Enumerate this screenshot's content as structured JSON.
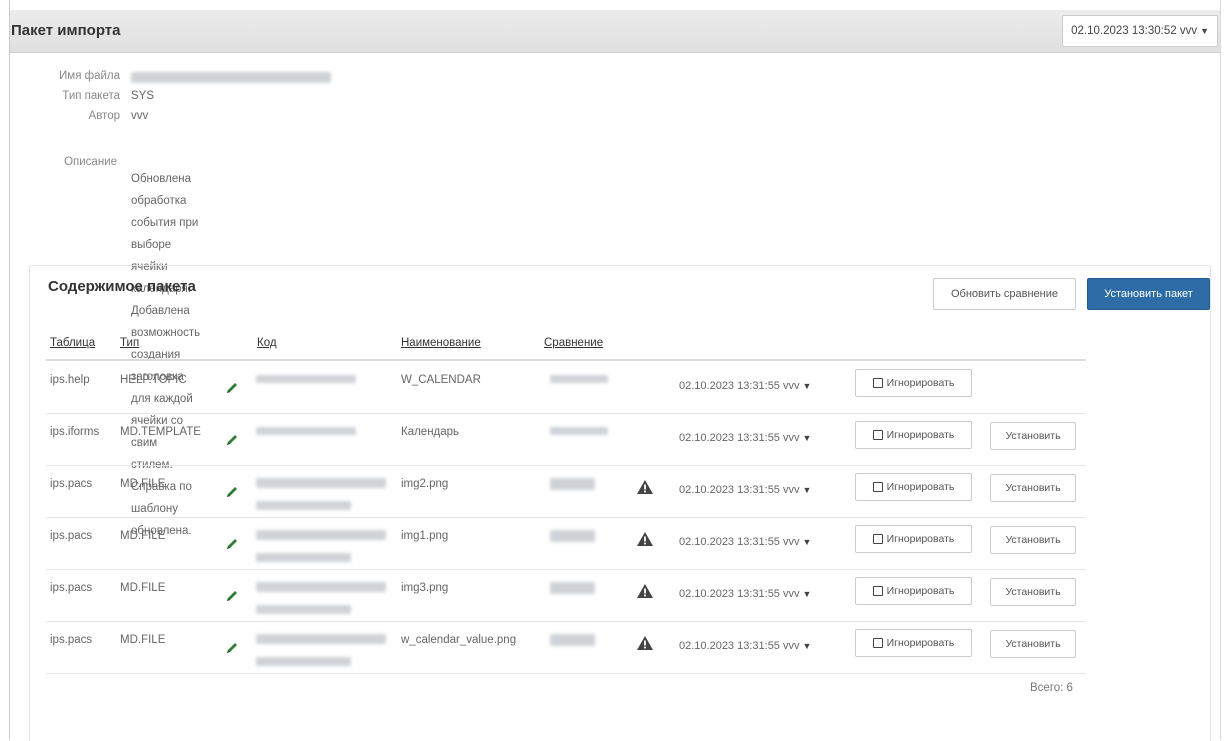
{
  "header": {
    "title": "Пакет импорта",
    "version_value": "02.10.2023 13:30:52 vvv"
  },
  "meta": {
    "filename_label": "Имя файла",
    "type_label": "Тип пакета",
    "type_value": "SYS",
    "author_label": "Автор",
    "author_value": "vvv",
    "description_label": "Описание",
    "description_lines": [
      "Обновлена обработка события при выборе ячейки календаря.",
      "Добавлена возможность создания заголовка для каждой ячейки со свим стилем.",
      "Справка по шаблону обновлена."
    ]
  },
  "content": {
    "title": "Содержимое пакета",
    "compare_button": "Обновить сравнение",
    "install_package_button": "Установить пакет",
    "columns": [
      "Таблица",
      "Тип",
      "Код",
      "Наименование",
      "Сравнение"
    ],
    "ignore_label": "Игнорировать",
    "install_label": "Установить",
    "rows": [
      {
        "table": "ips.help",
        "type": "HELP.TOPIC",
        "name": "W_CALENDAR",
        "date": "02.10.2023 13:31:55 vvv",
        "warning": false,
        "installable": false
      },
      {
        "table": "ips.iforms",
        "type": "MD.TEMPLATE",
        "name": "Календарь",
        "date": "02.10.2023 13:31:55 vvv",
        "warning": false,
        "installable": true
      },
      {
        "table": "ips.pacs",
        "type": "MD.FILE",
        "name": "img2.png",
        "date": "02.10.2023 13:31:55 vvv",
        "warning": true,
        "installable": true
      },
      {
        "table": "ips.pacs",
        "type": "MD.FILE",
        "name": "img1.png",
        "date": "02.10.2023 13:31:55 vvv",
        "warning": true,
        "installable": true
      },
      {
        "table": "ips.pacs",
        "type": "MD.FILE",
        "name": "img3.png",
        "date": "02.10.2023 13:31:55 vvv",
        "warning": true,
        "installable": true
      },
      {
        "table": "ips.pacs",
        "type": "MD.FILE",
        "name": "w_calendar_value.png",
        "date": "02.10.2023 13:31:55 vvv",
        "warning": true,
        "installable": true
      }
    ],
    "total": "Всего: 6"
  },
  "icons": {
    "edit": "pencil-icon",
    "warning": "warning-triangle-icon",
    "dropdown": "caret-down-icon",
    "checkbox": "checkbox-icon"
  },
  "colors": {
    "pencil": "#2e7d32",
    "primary_button": "#2e6ca8"
  }
}
